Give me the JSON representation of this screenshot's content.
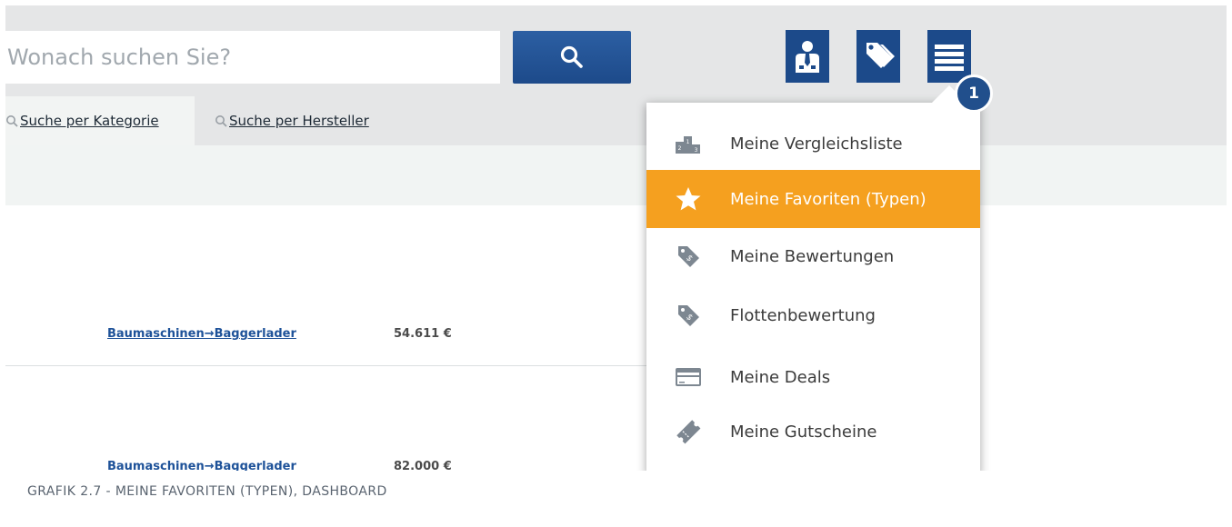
{
  "search": {
    "placeholder": "Wonach suchen Sie?",
    "button_icon": "magnifier-icon"
  },
  "header_icons": [
    {
      "name": "person-badge-icon"
    },
    {
      "name": "price-tags-icon"
    },
    {
      "name": "hamburger-menu-icon"
    }
  ],
  "badge": "1",
  "tabs": {
    "category": "Suche per Kategorie",
    "manufacturer": "Suche per Hersteller"
  },
  "rows": [
    {
      "link": "Baumaschinen→Baggerlader",
      "price": "54.611 €"
    },
    {
      "link": "Baumaschinen→Baggerlader",
      "price": "82.000 €"
    }
  ],
  "menu": {
    "items": [
      {
        "label": "Meine Vergleichsliste",
        "icon": "podium-icon"
      },
      {
        "label": "Meine Favoriten (Typen)",
        "icon": "star-icon"
      },
      {
        "label": "Meine Bewertungen",
        "icon": "price-tag-icon"
      },
      {
        "label": "Flottenbewertung",
        "icon": "price-tag-icon"
      },
      {
        "label": "Meine Deals",
        "icon": "credit-card-icon"
      },
      {
        "label": "Meine Gutscheine",
        "icon": "ticket-icon"
      }
    ]
  },
  "caption": "GRAFIK 2.7 - MEINE FAVORITEN (TYPEN), DASHBOARD",
  "colors": {
    "primary_blue": "#1c4a8a",
    "active_orange": "#f5a01f",
    "header_gray": "#e5e6e7",
    "link_blue": "#1e5299"
  }
}
